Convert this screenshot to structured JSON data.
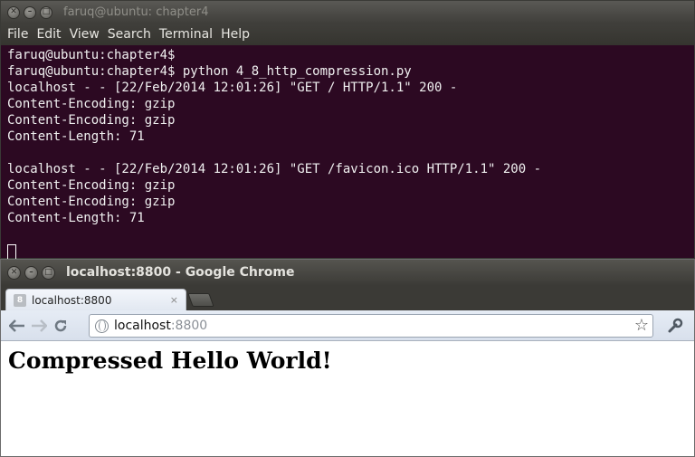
{
  "terminal": {
    "title": "faruq@ubuntu: chapter4",
    "menu": [
      "File",
      "Edit",
      "View",
      "Search",
      "Terminal",
      "Help"
    ],
    "lines": [
      "faruq@ubuntu:chapter4$",
      "faruq@ubuntu:chapter4$ python 4_8_http_compression.py",
      "localhost - - [22/Feb/2014 12:01:26] \"GET / HTTP/1.1\" 200 -",
      "Content-Encoding: gzip",
      "Content-Encoding: gzip",
      "Content-Length: 71",
      "",
      "localhost - - [22/Feb/2014 12:01:26] \"GET /favicon.ico HTTP/1.1\" 200 -",
      "Content-Encoding: gzip",
      "Content-Encoding: gzip",
      "Content-Length: 71",
      ""
    ]
  },
  "chrome": {
    "title": "localhost:8800 - Google Chrome",
    "tab": {
      "label": "localhost:8800",
      "close": "×",
      "favicon": "8"
    },
    "omnibox": {
      "host": "localhost",
      "port": ":8800"
    },
    "icons": {
      "back": "back-arrow-icon",
      "forward": "forward-arrow-icon",
      "reload": "reload-icon",
      "globe": "globe-icon",
      "star": "star-icon",
      "wrench": "wrench-icon"
    },
    "page": {
      "heading": "Compressed Hello World!"
    }
  },
  "colors": {
    "terminal_bg": "#2c0922",
    "terminal_text": "#f0f0f0",
    "titlebar": "#3f3e3a"
  }
}
